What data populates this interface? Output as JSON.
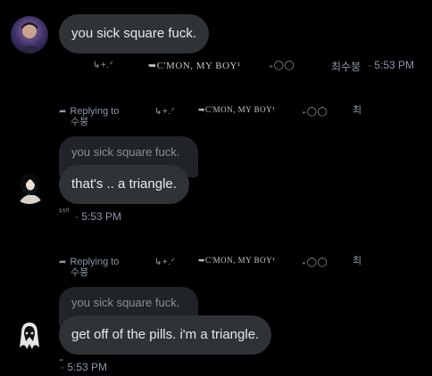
{
  "messages": [
    {
      "text": "you sick square fuck.",
      "footer": {
        "deco_left": "↳+.ᐟ",
        "arrow_text": "➥C'MON, MY BOY¹",
        "deco_right": "₊◯◯",
        "author": "최수붕",
        "time": "· 5:53 PM"
      }
    },
    {
      "reply_header": {
        "label": "Replying to",
        "name_rest": "수붕",
        "deco_left": "↳+.ᐟ",
        "arrow_text": "➥C'MON, MY BOY¹",
        "deco_right": "₊◯◯",
        "name_start": "최"
      },
      "quoted": "you sick square fuck.",
      "text": "that's .. a triangle.",
      "footer": {
        "prefix": "¹⁵⁰",
        "time": "· 5:53 PM"
      }
    },
    {
      "reply_header": {
        "label": "Replying to",
        "name_rest": "수붕",
        "deco_left": "↳+.ᐟ",
        "arrow_text": "➥C'MON, MY BOY¹",
        "deco_right": "₊◯◯",
        "name_start": "최"
      },
      "quoted": "you sick square fuck.",
      "text": "get off of the pills. i'm a triangle.",
      "footer": {
        "prefix": "⁼",
        "time": "· 5:53 PM"
      }
    }
  ],
  "colors": {
    "background": "#000000",
    "bubble": "#2f3336",
    "quoted_bubble": "#202327",
    "muted_text": "#8b98a5"
  }
}
